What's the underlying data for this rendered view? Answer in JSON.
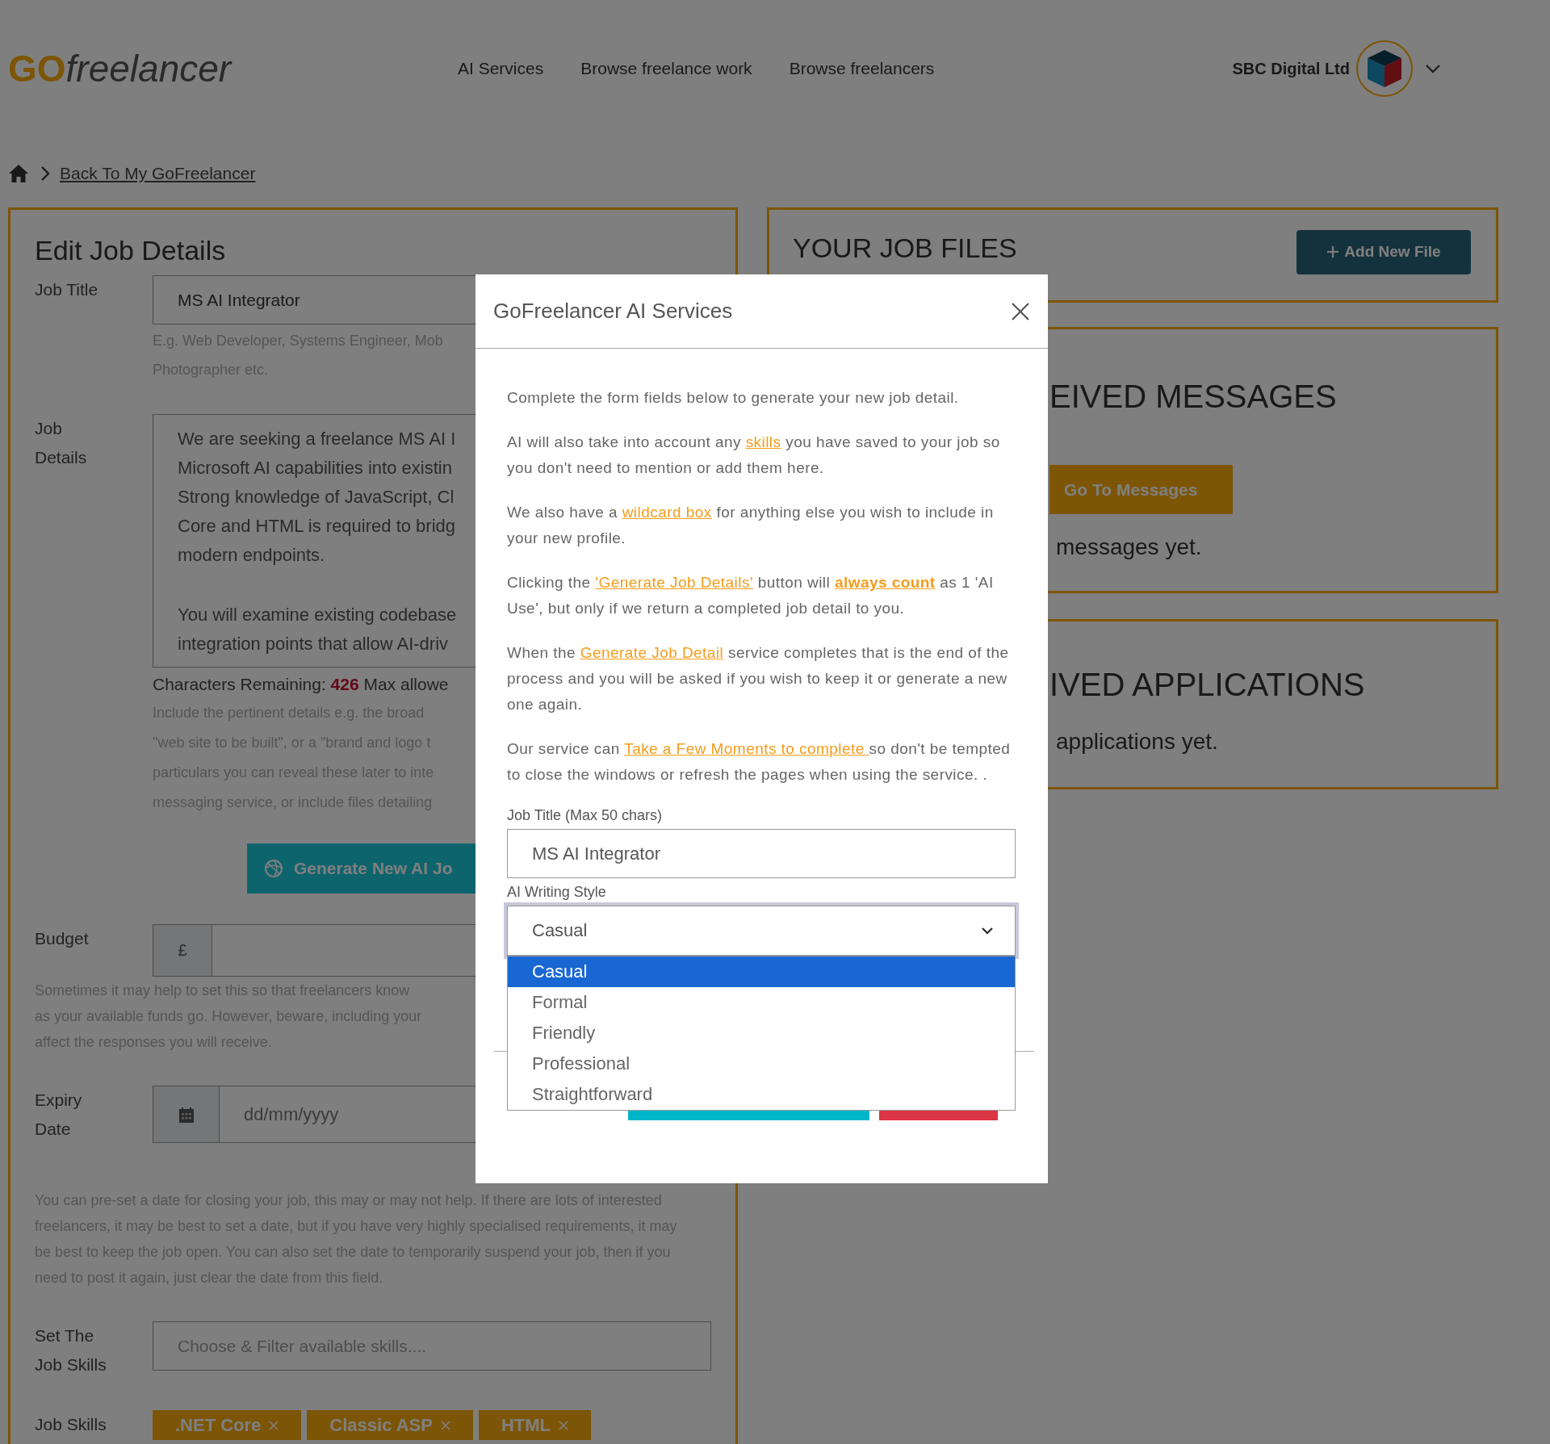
{
  "header": {
    "logo": {
      "strong": "GO",
      "rest": "freelancer"
    },
    "nav": [
      {
        "label": "AI Services"
      },
      {
        "label": "Browse freelance work"
      },
      {
        "label": "Browse freelancers"
      }
    ],
    "account": {
      "name": "SBC Digital Ltd"
    }
  },
  "breadcrumb": {
    "link": "Back To My GoFreelancer"
  },
  "edit_panel": {
    "title": "Edit Job Details",
    "job_title": {
      "label": "Job Title",
      "value": "MS AI Integrator",
      "hint_lines": [
        "E.g. Web Developer, Systems Engineer, Mob",
        "Photographer etc."
      ]
    },
    "job_details": {
      "label": "Job Details",
      "paragraphs": [
        [
          "We are seeking a freelance MS AI I",
          "Microsoft AI capabilities into existin",
          "Strong knowledge of JavaScript, Cl",
          "Core and HTML is required to bridg",
          "modern endpoints."
        ],
        [
          "You will examine existing codebase",
          "integration points that allow AI-driv"
        ]
      ],
      "chars": "Characters Remaining: **426** Max allowe",
      "hint_lines": [
        "Include the pertinent details e.g. the broad",
        "\"web site to be built\", or a \"brand and logo t",
        "particulars you can reveal these later to inte",
        "messaging service, or include files detailing"
      ]
    },
    "generate_button": "Generate New AI Jo",
    "budget": {
      "label": "Budget",
      "currency": "£",
      "hint_lines": [
        "Sometimes it may help to set this so that freelancers know",
        "as your available funds go. However, beware, including your",
        "affect the responses you will receive."
      ]
    },
    "expiry": {
      "label": "Expiry Date",
      "placeholder": "dd/mm/yyyy",
      "note": "You can pre-set a date for closing your job, this may or may not help. If there are lots of interested freelancers, it may be best to set a date, but if you have very highly specialised requirements, it may be best to keep the job open. You can also set the date to temporarily suspend your job, then if you need to post it again, just clear the date from this field."
    },
    "skills_filter": {
      "label": "Set The Job Skills",
      "placeholder": "Choose & Filter available skills...."
    },
    "job_skills": {
      "label": "Job Skills",
      "tags": [
        ".NET Core",
        "Classic ASP",
        "HTML"
      ]
    }
  },
  "job_files": {
    "title": "YOUR JOB FILES",
    "button": "Add New File"
  },
  "messages": {
    "title": "EIVED MESSAGES",
    "button": "Go To Messages",
    "text": "messages yet."
  },
  "applications": {
    "title": "IVED APPLICATIONS",
    "text": "applications yet."
  },
  "modal": {
    "title": "GoFreelancer AI Services",
    "paragraphs": [
      [
        {
          "kind": "plain",
          "text": "Complete the form fields below to generate your new job detail."
        }
      ],
      [
        {
          "kind": "plain",
          "text": "AI will also take into account any "
        },
        {
          "kind": "link",
          "text": "skills"
        },
        {
          "kind": "plain",
          "text": " you have saved to your job so you don't need to mention or add them here."
        }
      ],
      [
        {
          "kind": "plain",
          "text": "We also have a "
        },
        {
          "kind": "link",
          "text": "wildcard box"
        },
        {
          "kind": "plain",
          "text": " for anything else you wish to include in your new profile."
        }
      ],
      [
        {
          "kind": "plain",
          "text": "Clicking the "
        },
        {
          "kind": "link",
          "text": "'Generate Job Details'"
        },
        {
          "kind": "plain",
          "text": " button will "
        },
        {
          "kind": "bold-link",
          "text": "always count"
        },
        {
          "kind": "plain",
          "text": " as 1 'AI Use', but only if we return a completed job detail to you."
        }
      ],
      [
        {
          "kind": "plain",
          "text": "When the "
        },
        {
          "kind": "link",
          "text": "Generate Job Detail"
        },
        {
          "kind": "plain",
          "text": " service completes that is the end of the process and you will be asked if you wish to keep it or generate a new one again."
        }
      ],
      [
        {
          "kind": "plain",
          "text": "Our service can "
        },
        {
          "kind": "link",
          "text": "Take a Few Moments to complete "
        },
        {
          "kind": "plain",
          "text": "so don't be tempted to close the windows or refresh the pages when using the service. ."
        }
      ]
    ],
    "job_title": {
      "label": "Job Title (Max 50 chars)",
      "value": "MS AI Integrator"
    },
    "writing_style": {
      "label": "AI Writing Style",
      "value": "Casual",
      "expanded": true,
      "options": [
        {
          "label": "Casual",
          "selected": true
        },
        {
          "label": "Formal",
          "selected": false
        },
        {
          "label": "Friendly",
          "selected": false
        },
        {
          "label": "Professional",
          "selected": false
        },
        {
          "label": "Straightforward",
          "selected": false
        }
      ]
    }
  }
}
